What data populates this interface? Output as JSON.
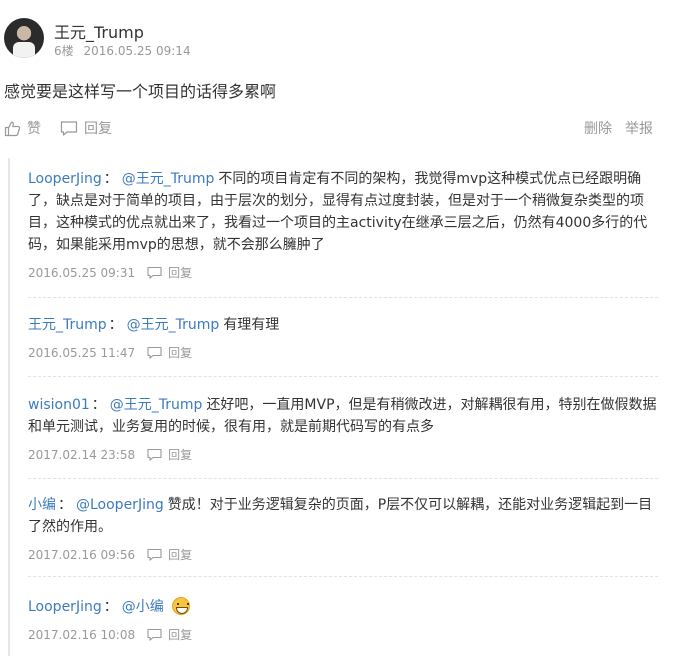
{
  "post": {
    "author": "王元_Trump",
    "floor": "6楼",
    "timestamp": "2016.05.25 09:14",
    "body": "感觉要是这样写一个项目的话得多累啊",
    "actions": {
      "like": "赞",
      "reply": "回复",
      "delete": "删除",
      "report": "举报"
    }
  },
  "comments": [
    {
      "user": "LooperJing",
      "mention": "@王元_Trump",
      "text": "不同的项目肯定有不同的架构，我觉得mvp这种模式优点已经跟明确了，缺点是对于简单的项目，由于层次的划分，显得有点过度封装，但是对于一个稍微复杂类型的项目，这种模式的优点就出来了，我看过一个项目的主activity在继承三层之后，仍然有4000多行的代码，如果能采用mvp的思想，就不会那么臃肿了",
      "time": "2016.05.25 09:31",
      "reply": "回复"
    },
    {
      "user": "王元_Trump",
      "mention": "@王元_Trump",
      "text": "有理有理",
      "time": "2016.05.25 11:47",
      "reply": "回复"
    },
    {
      "user": "wision01",
      "mention": "@王元_Trump",
      "text": "还好吧，一直用MVP，但是有稍微改进，对解耦很有用，特别在做假数据和单元测试，业务复用的时候，很有用，就是前期代码写的有点多",
      "time": "2017.02.14 23:58",
      "reply": "回复"
    },
    {
      "user": "小编",
      "mention": "@LooperJing",
      "text": "赞成！对于业务逻辑复杂的页面，P层不仅可以解耦，还能对业务逻辑起到一目了然的作用。",
      "time": "2017.02.16 09:56",
      "reply": "回复"
    },
    {
      "user": "LooperJing",
      "mention": "@小编",
      "text": "",
      "emoji": "grinning-face-emoji",
      "time": "2017.02.16 10:08",
      "reply": "回复"
    }
  ],
  "colors": {
    "link": "#3c7bbf",
    "muted": "#999999",
    "text": "#333333"
  }
}
